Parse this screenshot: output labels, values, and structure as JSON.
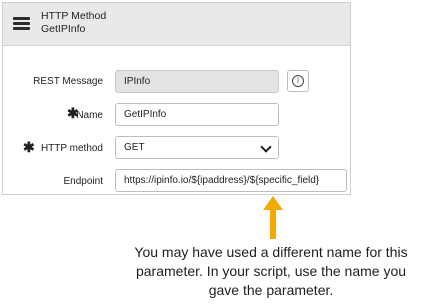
{
  "header": {
    "line1": "HTTP Method",
    "line2": "GetIPInfo"
  },
  "form": {
    "rest_message": {
      "label": "REST Message",
      "value": "IPInfo"
    },
    "name": {
      "label": "Name",
      "value": "GetIPInfo",
      "required_mark": "✱"
    },
    "http_method": {
      "label": "HTTP method",
      "value": "GET",
      "required_mark": "✱"
    },
    "endpoint": {
      "label": "Endpoint",
      "value": "https://ipinfo.io/${ipaddress}/${specific_field}"
    }
  },
  "icons": {
    "info": "ⓘ",
    "menu": "hamburger-menu-icon"
  },
  "annotation": {
    "line1": "You may have used a different name for this",
    "line2": "parameter. In your script, use the name you",
    "line3": "gave the parameter."
  },
  "colors": {
    "arrow": "#f2a900",
    "header_bg": "#e9e9e9",
    "readonly_bg": "#e3e3e3"
  }
}
